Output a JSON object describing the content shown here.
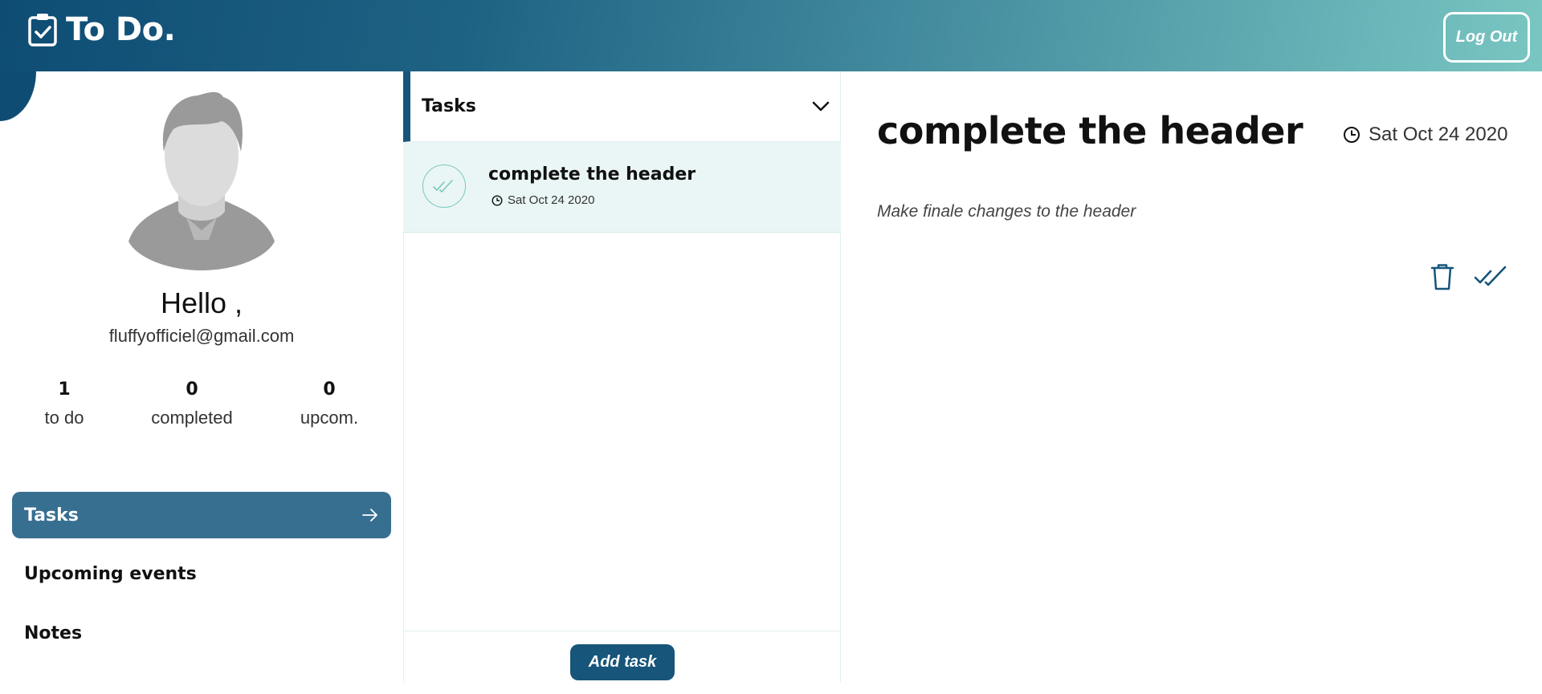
{
  "header": {
    "brand": "To Do.",
    "logout_label": "Log Out"
  },
  "profile": {
    "greeting": "Hello ,",
    "email": "fluffyofficiel@gmail.com",
    "stats": [
      {
        "value": "1",
        "label": "to do"
      },
      {
        "value": "0",
        "label": "completed"
      },
      {
        "value": "0",
        "label": "upcom."
      }
    ]
  },
  "nav": {
    "items": [
      {
        "label": "Tasks",
        "active": true
      },
      {
        "label": "Upcoming events",
        "active": false
      },
      {
        "label": "Notes",
        "active": false
      }
    ]
  },
  "task_list": {
    "header": "Tasks",
    "tasks": [
      {
        "title": "complete the header",
        "date": "Sat Oct 24 2020"
      }
    ],
    "add_label": "Add task"
  },
  "detail": {
    "title": "complete the header",
    "date": "Sat Oct 24 2020",
    "description": "Make finale changes to the header"
  },
  "colors": {
    "primary": "#17557a",
    "accent": "#79c6c2",
    "nav_active": "#376f90",
    "task_row_bg": "#eaf6f5"
  },
  "icons": {
    "brand": "clipboard-check-icon",
    "nav_arrow": "arrow-right-icon",
    "collapse": "chevron-down-icon",
    "task_check": "double-check-icon",
    "clock": "clock-icon",
    "delete": "trash-icon",
    "complete": "double-check-icon"
  }
}
